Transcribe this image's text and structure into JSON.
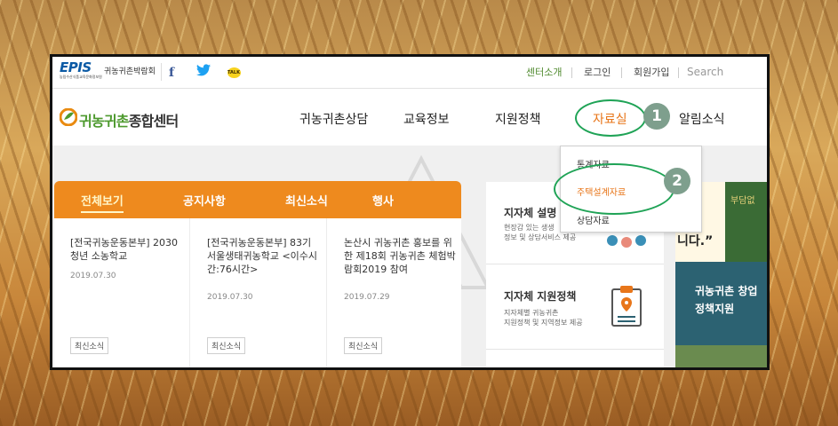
{
  "topbar": {
    "logo_text": "EPIS",
    "logo_sub": "농림수산식품교육문화정보원",
    "expo_link": "귀농귀촌박람회",
    "facebook_glyph": "f",
    "talk_text": "TALK",
    "center_intro": "센터소개",
    "login": "로그인",
    "signup": "회원가입",
    "search_placeholder": "Search"
  },
  "header": {
    "logo_part1": "귀농귀촌",
    "logo_part2": "종합센터",
    "nav": [
      "귀농귀촌상담",
      "교육정보",
      "지원정책",
      "자료실",
      "알림소식"
    ]
  },
  "dropdown": {
    "items": [
      "통계자료",
      "주택설계자료",
      "상담자료"
    ]
  },
  "annotations": {
    "step1": "1",
    "step2": "2",
    "highlight_color": "#1fa356"
  },
  "news_tabs": [
    "전체보기",
    "공지사항",
    "최신소식",
    "행사"
  ],
  "news_cards": [
    {
      "title": "[전국귀농운동본부] 2030 청년 소농학교",
      "date": "2019.07.30",
      "badge": "최신소식"
    },
    {
      "title": "[전국귀농운동본부] 83기 서울생태귀농학교 <이수시간:76시간>",
      "date": "2019.07.30",
      "badge": "최신소식"
    },
    {
      "title": "논산시 귀농귀촌 홍보를 위한 제18회 귀농귀촌 체험박람회2019 참여",
      "date": "2019.07.29",
      "badge": "최신소식"
    }
  ],
  "side_boxes": [
    {
      "title": "지자체 설명",
      "desc1": "현장감 있는 생생",
      "desc2": "정보 및 상담서비스 제공"
    },
    {
      "title": "지자체 지원정책",
      "desc1": "지자체별 귀농귀촌",
      "desc2": "지원정책 및 지역정보 제공"
    }
  ],
  "banner": {
    "quote": "니다.”",
    "top_text": "부담없",
    "line1": "귀농귀촌 창업",
    "line2": "정책지원"
  },
  "colors": {
    "accent_orange": "#ee8a1e",
    "active_nav": "#e8761a",
    "brand_green": "#4e9a2f",
    "brand_blue": "#0b5aa5"
  }
}
